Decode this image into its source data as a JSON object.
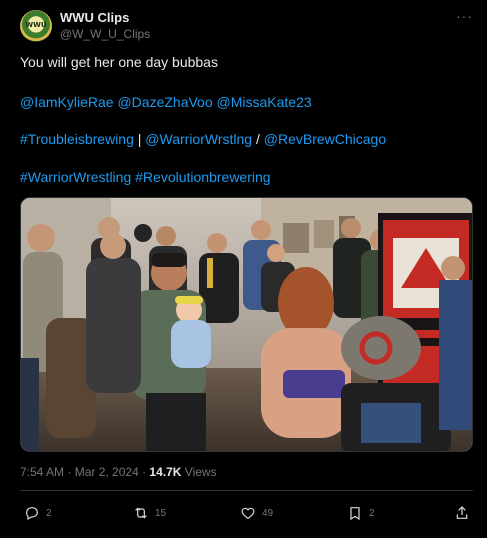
{
  "account": {
    "name": "WWU Clips",
    "handle": "@W_W_U_Clips",
    "avatar_text": "WWU"
  },
  "tweet": {
    "line1": "You will get her one day bubbas",
    "mentions": [
      "@IamKylieRae",
      "@DazeZhaVoo",
      "@MissaKate23"
    ],
    "line3": {
      "tag1": "#Troubleisbrewing",
      "sep1": " | ",
      "mention1": "@WarriorWrstlng",
      "sep2": " / ",
      "mention2": "@RevBrewChicago"
    },
    "hashtags": [
      "#WarriorWrestling",
      "#Revolutionbrewering"
    ]
  },
  "meta": {
    "time": "7:54 AM",
    "dot1": " · ",
    "date": "Mar 2, 2024",
    "dot2": " · ",
    "views_count": "14.7K",
    "views_label": " Views"
  },
  "actions": {
    "replies": "2",
    "reposts": "15",
    "likes": "49",
    "bookmarks": "2"
  },
  "colors": {
    "background": "#000000",
    "link": "#1d9bf0",
    "muted": "#71767b",
    "text": "#e7e9ea"
  }
}
